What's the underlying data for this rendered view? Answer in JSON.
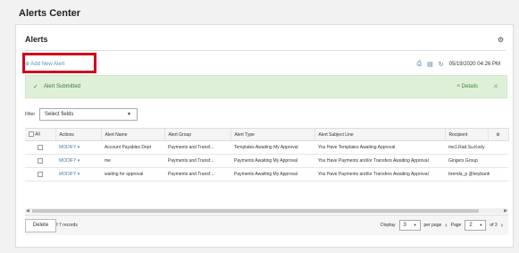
{
  "page_title": "Alerts Center",
  "card": {
    "title": "Alerts",
    "add_link": "Add New Alert",
    "timestamp": "05/19/2020 04:26 PM"
  },
  "banner": {
    "message": "Alert Submitted",
    "details": "Details"
  },
  "filter": {
    "label": "Filter",
    "value": "Select fields"
  },
  "table": {
    "headers": [
      "All",
      "Actions",
      "Alert Name",
      "Alert Group",
      "Alert Type",
      "Alert Subject Line",
      "Recipient"
    ],
    "rows": [
      {
        "action": "MODIFY",
        "name": "Account Payables Dept",
        "group": "Payments and Transf...",
        "type": "Templates Awaiting My Approval",
        "subject": "You Have Templates Awaiting Approval",
        "recipient": "me1.Rad.Su.Kody"
      },
      {
        "action": "MODIFY",
        "name": "me",
        "group": "Payments and Transf...",
        "type": "Payments Awaiting My Approval",
        "subject": "You Have Payments and/or Transfers Awaiting Approval",
        "recipient": "Gingers Group"
      },
      {
        "action": "MODIFY",
        "name": "waiting for approval",
        "group": "Payments and Transf...",
        "type": "Payments Awaiting My Approval",
        "subject": "You Have Payments and/or Transfers Awaiting Approval",
        "recipient": "brenda_p    @keybank"
      }
    ]
  },
  "footer": {
    "viewing": "Viewing 4-6 of 7 records",
    "display_label": "Display",
    "display_value": "3",
    "per_page": "per page",
    "page_label": "Page",
    "page_value": "2",
    "of_pages": "of 3"
  },
  "delete_label": "Delete"
}
